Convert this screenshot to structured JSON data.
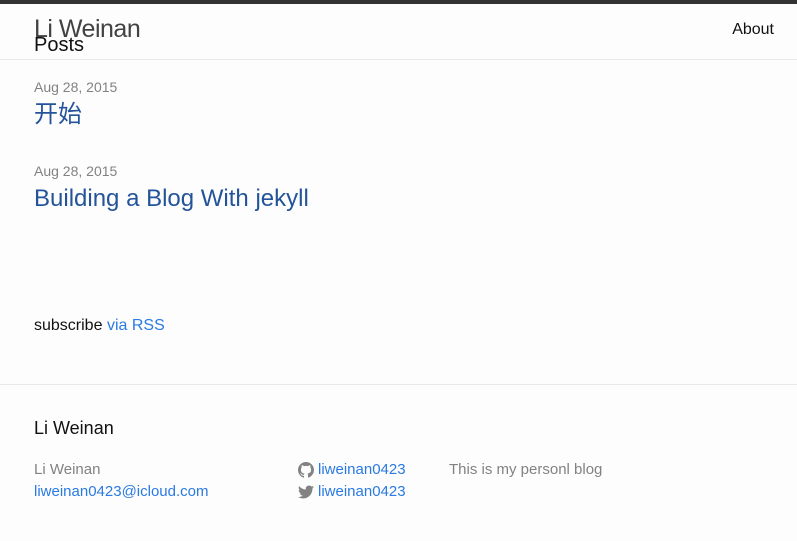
{
  "header": {
    "site_title": "Li Weinan",
    "nav": [
      {
        "label": "About"
      }
    ]
  },
  "main": {
    "heading": "Posts",
    "posts": [
      {
        "date": "Aug 28, 2015",
        "title": "开始"
      },
      {
        "date": "Aug 28, 2015",
        "title": "Building a Blog With jekyll"
      }
    ],
    "rss_prefix": "subscribe",
    "rss_link": "via RSS"
  },
  "footer": {
    "heading": "Li Weinan",
    "name": "Li Weinan",
    "email": "liweinan0423@icloud.com",
    "github": "liweinan0423",
    "twitter": "liweinan0423",
    "description": "This is my personl blog"
  },
  "colors": {
    "link": "#2a7ae2",
    "post_title": "#23549a",
    "header_border": "#333333",
    "muted": "#828282"
  }
}
